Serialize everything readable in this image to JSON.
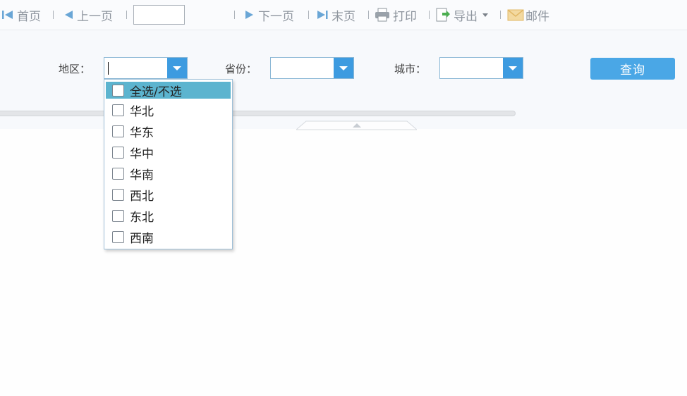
{
  "toolbar": {
    "first_label": "首页",
    "prev_label": "上一页",
    "page_value": "",
    "next_label": "下一页",
    "last_label": "末页",
    "print_label": "打印",
    "export_label": "导出",
    "mail_label": "邮件"
  },
  "filters": {
    "region_label": "地区：",
    "region_value": "",
    "province_label": "省份：",
    "province_value": "",
    "city_label": "城市：",
    "city_value": "",
    "query_label": "查询"
  },
  "dropdown": {
    "options": [
      {
        "label": "全选/不选",
        "checked": false
      },
      {
        "label": "华北",
        "checked": false
      },
      {
        "label": "华东",
        "checked": false
      },
      {
        "label": "华中",
        "checked": false
      },
      {
        "label": "华南",
        "checked": false
      },
      {
        "label": "西北",
        "checked": false
      },
      {
        "label": "东北",
        "checked": false
      },
      {
        "label": "西南",
        "checked": false
      }
    ]
  },
  "colors": {
    "accent": "#3d9be0",
    "query_button": "#4aa7e6",
    "selected_option": "#5cb4cf",
    "toolbar_text": "#8f969f"
  },
  "icons": [
    "first-page-icon",
    "prev-page-icon",
    "next-page-icon",
    "last-page-icon",
    "printer-icon",
    "export-icon",
    "dropdown-arrow-icon",
    "mail-icon"
  ]
}
